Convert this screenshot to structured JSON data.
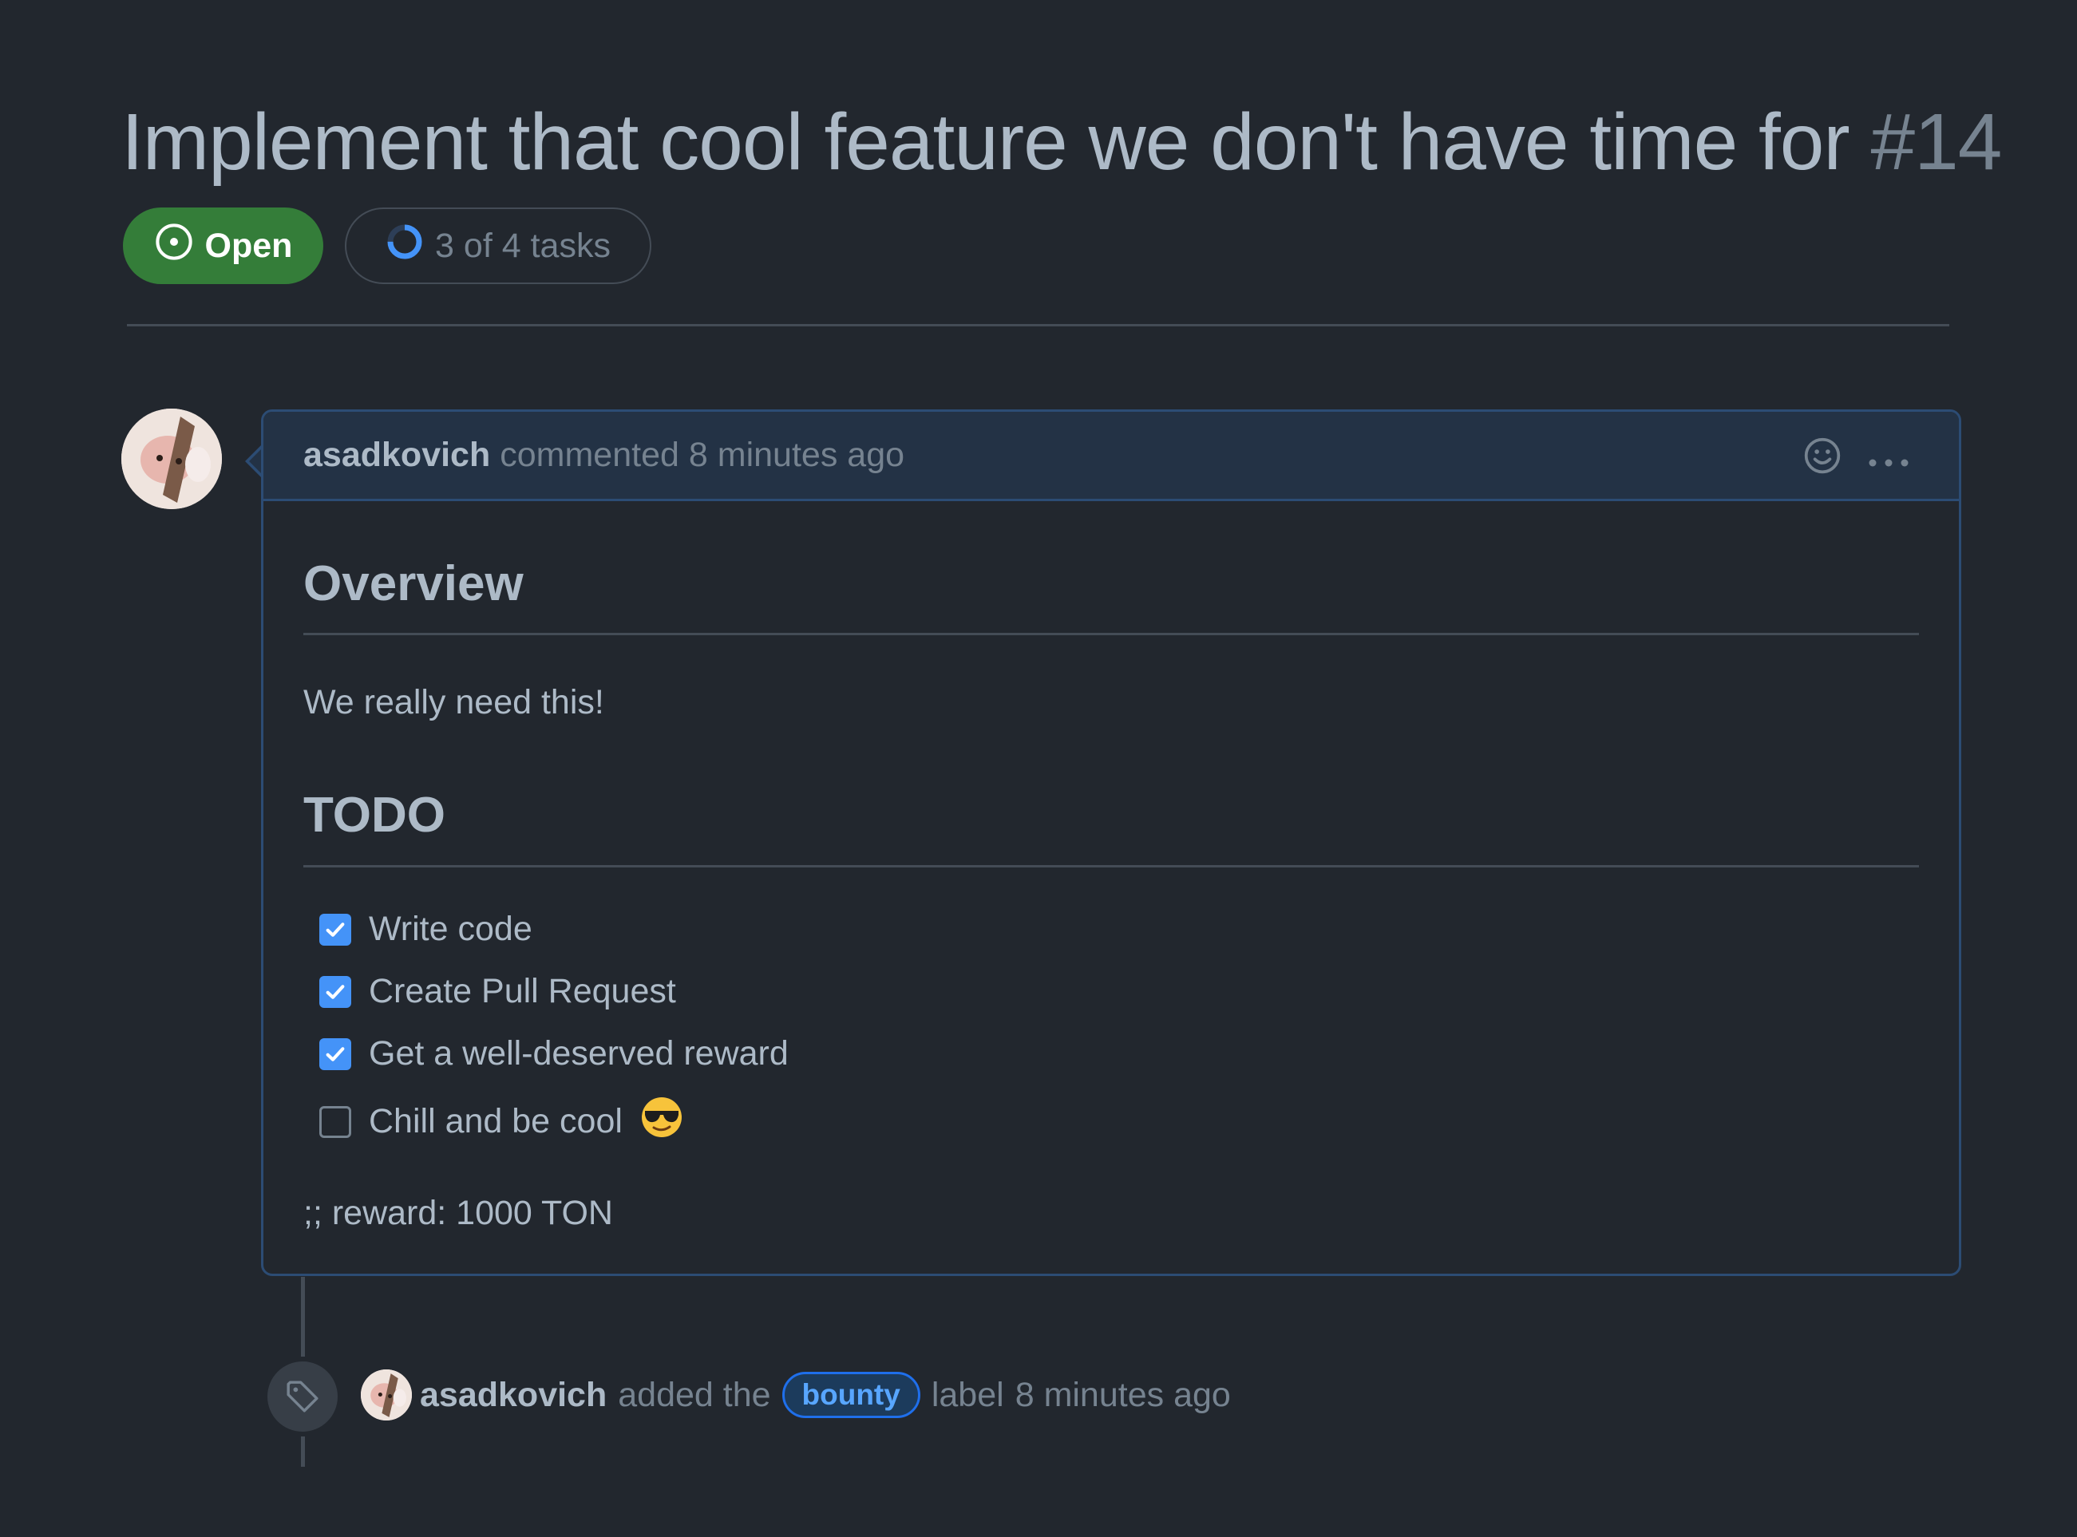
{
  "issue": {
    "title": "Implement that cool feature we don't have time for",
    "number": "#14",
    "state": "Open",
    "tasks_progress": "3 of 4 tasks",
    "tasks_fraction": 0.75
  },
  "comment": {
    "author": "asadkovich",
    "action": "commented",
    "time": "8 minutes ago",
    "heading_overview": "Overview",
    "overview_text": "We really need this!",
    "heading_todo": "TODO",
    "tasks": [
      {
        "label": "Write code",
        "checked": true
      },
      {
        "label": "Create Pull Request",
        "checked": true
      },
      {
        "label": "Get a well-deserved reward",
        "checked": true
      },
      {
        "label": "Chill and be cool",
        "checked": false
      }
    ],
    "reward": ";; reward: 1000 TON"
  },
  "event": {
    "author": "asadkovich",
    "action": "added the",
    "label": "bounty",
    "suffix": "label",
    "time": "8 minutes ago"
  },
  "colors": {
    "background": "#22272e",
    "open_green": "#347d39",
    "accent_blue": "#4493f8",
    "comment_border": "#2c4c74"
  }
}
